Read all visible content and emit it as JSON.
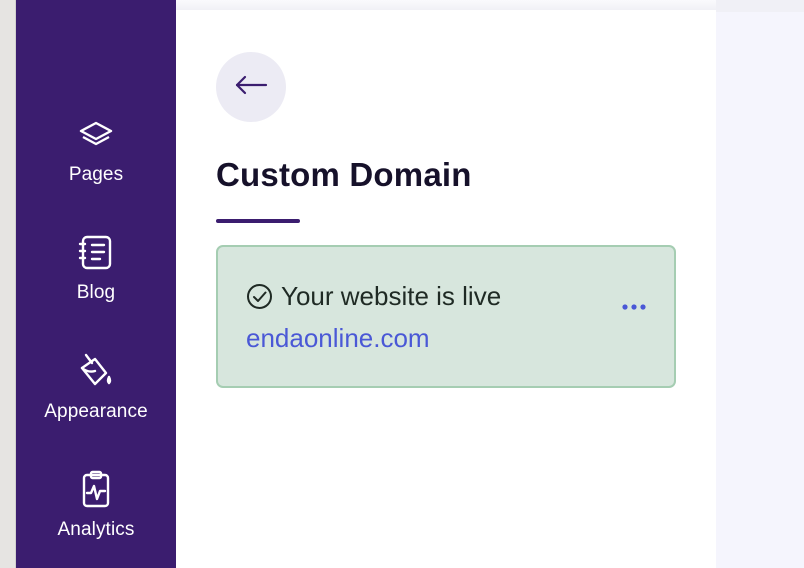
{
  "sidebar": {
    "items": [
      {
        "label": "Pages",
        "icon": "layers-icon"
      },
      {
        "label": "Blog",
        "icon": "notebook-icon"
      },
      {
        "label": "Appearance",
        "icon": "paint-bucket-icon"
      },
      {
        "label": "Analytics",
        "icon": "clipboard-pulse-icon"
      }
    ]
  },
  "header": {
    "back_icon": "arrow-left-icon",
    "title": "Custom Domain"
  },
  "domain_card": {
    "status_icon": "check-circle-icon",
    "status_text": "Your website is live",
    "domain": "endaonline.com",
    "menu_icon": "more-horizontal-icon"
  },
  "colors": {
    "sidebar_bg": "#3b1d6f",
    "accent": "#3b1d6f",
    "card_bg": "#d7e6dd",
    "card_border": "#a5cdb2",
    "link": "#4a58d6"
  }
}
